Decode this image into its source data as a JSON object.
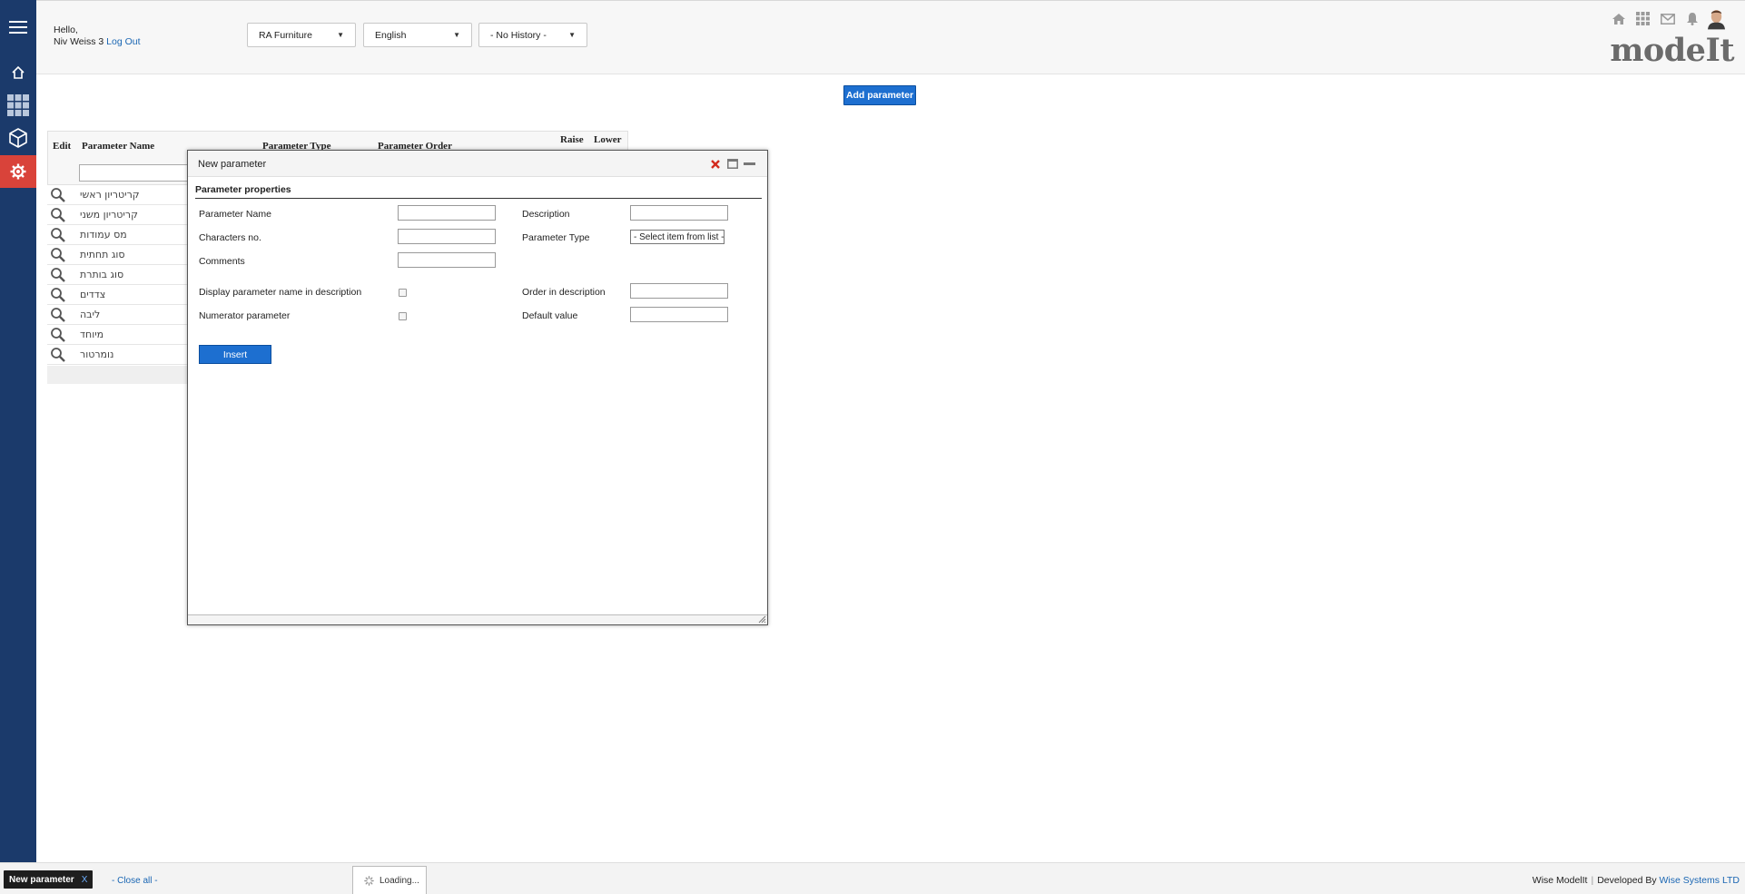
{
  "header": {
    "greeting_line1": "Hello,",
    "user_name": "Niv Weiss 3",
    "logout_label": "Log Out",
    "company_select": "RA Furniture",
    "language_select": "English",
    "history_select": "- No History -",
    "logo_text": "modeIt"
  },
  "toolbar": {
    "add_parameter_label": "Add parameter"
  },
  "table": {
    "columns": [
      "Edit",
      "Parameter Name",
      "Parameter Type",
      "Parameter Order",
      "Raise",
      "Lower"
    ],
    "rows": [
      {
        "name": "קריטריון ראשי"
      },
      {
        "name": "קריטריון משני"
      },
      {
        "name": "מס עמודות"
      },
      {
        "name": "סוג תחתית"
      },
      {
        "name": "סוג בותרת"
      },
      {
        "name": "צדדים"
      },
      {
        "name": "ליבה"
      },
      {
        "name": "מיוחד"
      },
      {
        "name": "נומרטור"
      }
    ]
  },
  "modal": {
    "title": "New parameter",
    "section_title": "Parameter properties",
    "labels": {
      "parameter_name": "Parameter Name",
      "description": "Description",
      "characters_no": "Characters no.",
      "parameter_type": "Parameter Type",
      "comments": "Comments",
      "display_in_description": "Display parameter name in description",
      "order_in_description": "Order in description",
      "numerator_parameter": "Numerator parameter",
      "default_value": "Default value"
    },
    "parameter_type_select": "- Select item from list -",
    "insert_label": "Insert"
  },
  "bottom": {
    "taskbar_item": "New parameter",
    "taskbar_close": "X",
    "close_all": "- Close all -",
    "loading": "Loading...",
    "product": "Wise ModelIt",
    "developed_by": "Developed By",
    "company": "Wise Systems LTD"
  },
  "colors": {
    "sidebar": "#1b3a6b",
    "active_nav": "#d9433a",
    "primary_button": "#1d6fd0",
    "link": "#1a66b3"
  }
}
